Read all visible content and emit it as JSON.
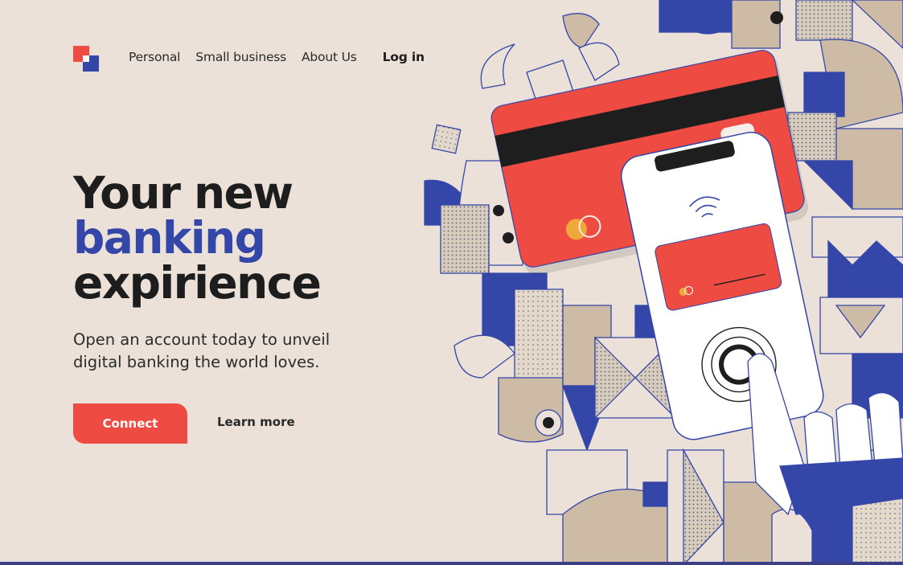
{
  "brand": {
    "colors": {
      "red": "#ee4c43",
      "blue": "#3446a8",
      "background": "#ebe1d8",
      "beige": "#cdbba6",
      "dark": "#1e1e1e"
    }
  },
  "nav": {
    "items": [
      {
        "label": "Personal"
      },
      {
        "label": "Small business"
      },
      {
        "label": "About Us"
      }
    ],
    "login_label": "Log in"
  },
  "hero": {
    "title_line1": "Your new",
    "title_line2": "banking",
    "title_line3": "expirience",
    "subtitle": "Open an account today to unveil digital banking the world loves.",
    "primary_button": "Connect",
    "secondary_link": "Learn more"
  },
  "illustration": {
    "description_icons": [
      "credit-card-icon",
      "smartphone-icon",
      "contactless-icon",
      "fingerprint-icon",
      "hand-icon"
    ]
  }
}
